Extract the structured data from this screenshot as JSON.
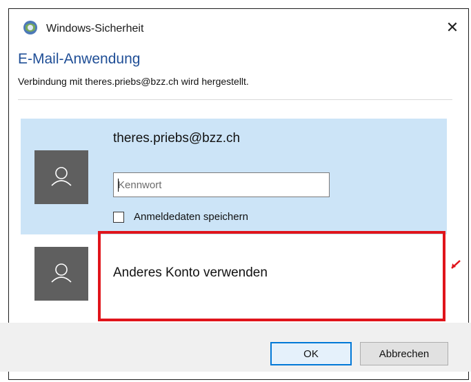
{
  "window": {
    "title": "Windows-Sicherheit",
    "close_glyph": "✕"
  },
  "dialog": {
    "heading": "E-Mail-Anwendung",
    "subheading": "Verbindung mit theres.priebs@bzz.ch wird hergestellt."
  },
  "account": {
    "email": "theres.priebs@bzz.ch",
    "password_placeholder": "Kennwort",
    "password_value": "",
    "remember_label": "Anmeldedaten speichern",
    "remember_checked": false
  },
  "other_account": {
    "label": "Anderes Konto verwenden"
  },
  "buttons": {
    "ok": "OK",
    "cancel": "Abbrechen"
  },
  "icons": {
    "app": "windows-security-icon",
    "avatar": "user-avatar-icon",
    "close": "close-icon"
  },
  "colors": {
    "heading": "#1f4e96",
    "selected_bg": "#cce4f7",
    "avatar_bg": "#5f5f5f",
    "annotation": "#e0141b",
    "accent": "#0078d7"
  }
}
